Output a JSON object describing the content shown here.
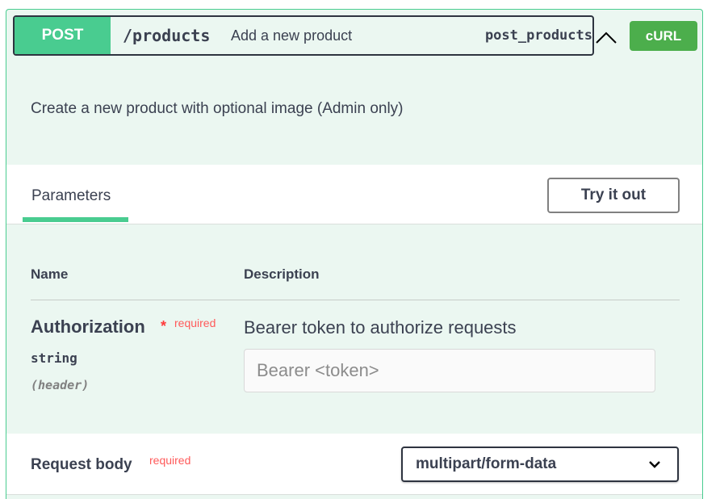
{
  "operation": {
    "method": "POST",
    "path": "/products",
    "summary": "Add a new product",
    "operation_id": "post_products",
    "curl_label": "cURL",
    "description": "Create a new product with optional image (Admin only)"
  },
  "parameters": {
    "tab_label": "Parameters",
    "try_label": "Try it out",
    "col_name": "Name",
    "col_description": "Description",
    "items": [
      {
        "name": "Authorization",
        "required_mark": "*",
        "required_label": "required",
        "type": "string",
        "location": "(header)",
        "description": "Bearer token to authorize requests",
        "placeholder": "Bearer <token>",
        "value": ""
      }
    ]
  },
  "request_body": {
    "label": "Request body",
    "required_label": "required",
    "content_type": "multipart/form-data"
  },
  "colors": {
    "post_accent": "#49cc90",
    "post_background": "#ebf7f1",
    "curl_button": "#4cae4c",
    "required": "#ff3b3b"
  },
  "icons": {
    "collapse": "chevron-up-icon",
    "dropdown": "chevron-down-icon"
  }
}
